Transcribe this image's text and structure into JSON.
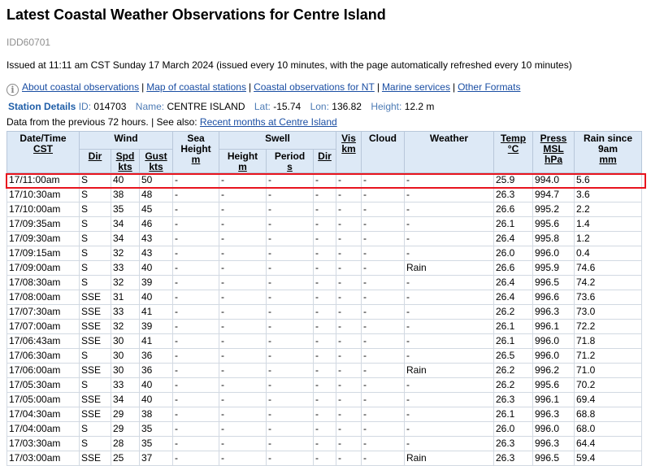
{
  "page": {
    "title": "Latest Coastal Weather Observations for Centre Island",
    "product_id": "IDD60701",
    "issued": "Issued at 11:11 am CST Sunday 17 March 2024 (issued every 10 minutes, with the page automatically refreshed every 10 minutes)"
  },
  "links": [
    "About coastal observations",
    "Map of coastal stations",
    "Coastal observations for NT",
    "Marine services",
    "Other Formats"
  ],
  "station": {
    "details_label": "Station Details",
    "id_label": "ID:",
    "id": "014703",
    "name_label": "Name:",
    "name": "CENTRE ISLAND",
    "lat_label": "Lat:",
    "lat": "-15.74",
    "lon_label": "Lon:",
    "lon": "136.82",
    "height_label": "Height:",
    "height": "12.2 m"
  },
  "data_from": {
    "text": "Data from the previous 72 hours. | See also:",
    "link": "Recent months at Centre Island"
  },
  "headers": {
    "datetime": [
      "Date/Time",
      "CST"
    ],
    "wind": "Wind",
    "wind_dir": "Dir",
    "wind_spd": [
      "Spd",
      "kts"
    ],
    "wind_gust": [
      "Gust",
      "kts"
    ],
    "sea_height": [
      "Sea",
      "Height",
      "m"
    ],
    "swell": "Swell",
    "swell_height": [
      "Height",
      "m"
    ],
    "swell_period": [
      "Period",
      "s"
    ],
    "swell_dir": "Dir",
    "vis": [
      "Vis",
      "km"
    ],
    "cloud": "Cloud",
    "weather": "Weather",
    "temp": [
      "Temp",
      "°C"
    ],
    "press": [
      "Press",
      "MSL",
      "hPa"
    ],
    "rain": [
      "Rain since",
      "9am",
      "mm"
    ]
  },
  "rows": [
    [
      "17/11:00am",
      "S",
      "40",
      "50",
      "-",
      "-",
      "-",
      "-",
      "-",
      "-",
      "-",
      "25.9",
      "994.0",
      "5.6"
    ],
    [
      "17/10:30am",
      "S",
      "38",
      "48",
      "-",
      "-",
      "-",
      "-",
      "-",
      "-",
      "-",
      "26.3",
      "994.7",
      "3.6"
    ],
    [
      "17/10:00am",
      "S",
      "35",
      "45",
      "-",
      "-",
      "-",
      "-",
      "-",
      "-",
      "-",
      "26.6",
      "995.2",
      "2.2"
    ],
    [
      "17/09:35am",
      "S",
      "34",
      "46",
      "-",
      "-",
      "-",
      "-",
      "-",
      "-",
      "-",
      "26.1",
      "995.6",
      "1.4"
    ],
    [
      "17/09:30am",
      "S",
      "34",
      "43",
      "-",
      "-",
      "-",
      "-",
      "-",
      "-",
      "-",
      "26.4",
      "995.8",
      "1.2"
    ],
    [
      "17/09:15am",
      "S",
      "32",
      "43",
      "-",
      "-",
      "-",
      "-",
      "-",
      "-",
      "-",
      "26.0",
      "996.0",
      "0.4"
    ],
    [
      "17/09:00am",
      "S",
      "33",
      "40",
      "-",
      "-",
      "-",
      "-",
      "-",
      "-",
      "Rain",
      "26.6",
      "995.9",
      "74.6"
    ],
    [
      "17/08:30am",
      "S",
      "32",
      "39",
      "-",
      "-",
      "-",
      "-",
      "-",
      "-",
      "-",
      "26.4",
      "996.5",
      "74.2"
    ],
    [
      "17/08:00am",
      "SSE",
      "31",
      "40",
      "-",
      "-",
      "-",
      "-",
      "-",
      "-",
      "-",
      "26.4",
      "996.6",
      "73.6"
    ],
    [
      "17/07:30am",
      "SSE",
      "33",
      "41",
      "-",
      "-",
      "-",
      "-",
      "-",
      "-",
      "-",
      "26.2",
      "996.3",
      "73.0"
    ],
    [
      "17/07:00am",
      "SSE",
      "32",
      "39",
      "-",
      "-",
      "-",
      "-",
      "-",
      "-",
      "-",
      "26.1",
      "996.1",
      "72.2"
    ],
    [
      "17/06:43am",
      "SSE",
      "30",
      "41",
      "-",
      "-",
      "-",
      "-",
      "-",
      "-",
      "-",
      "26.1",
      "996.0",
      "71.8"
    ],
    [
      "17/06:30am",
      "S",
      "30",
      "36",
      "-",
      "-",
      "-",
      "-",
      "-",
      "-",
      "-",
      "26.5",
      "996.0",
      "71.2"
    ],
    [
      "17/06:00am",
      "SSE",
      "30",
      "36",
      "-",
      "-",
      "-",
      "-",
      "-",
      "-",
      "Rain",
      "26.2",
      "996.2",
      "71.0"
    ],
    [
      "17/05:30am",
      "S",
      "33",
      "40",
      "-",
      "-",
      "-",
      "-",
      "-",
      "-",
      "-",
      "26.2",
      "995.6",
      "70.2"
    ],
    [
      "17/05:00am",
      "SSE",
      "34",
      "40",
      "-",
      "-",
      "-",
      "-",
      "-",
      "-",
      "-",
      "26.3",
      "996.1",
      "69.4"
    ],
    [
      "17/04:30am",
      "SSE",
      "29",
      "38",
      "-",
      "-",
      "-",
      "-",
      "-",
      "-",
      "-",
      "26.1",
      "996.3",
      "68.8"
    ],
    [
      "17/04:00am",
      "S",
      "29",
      "35",
      "-",
      "-",
      "-",
      "-",
      "-",
      "-",
      "-",
      "26.0",
      "996.0",
      "68.0"
    ],
    [
      "17/03:30am",
      "S",
      "28",
      "35",
      "-",
      "-",
      "-",
      "-",
      "-",
      "-",
      "-",
      "26.3",
      "996.3",
      "64.4"
    ],
    [
      "17/03:00am",
      "SSE",
      "25",
      "37",
      "-",
      "-",
      "-",
      "-",
      "-",
      "-",
      "Rain",
      "26.3",
      "996.5",
      "59.4"
    ]
  ],
  "highlight_row": 0
}
